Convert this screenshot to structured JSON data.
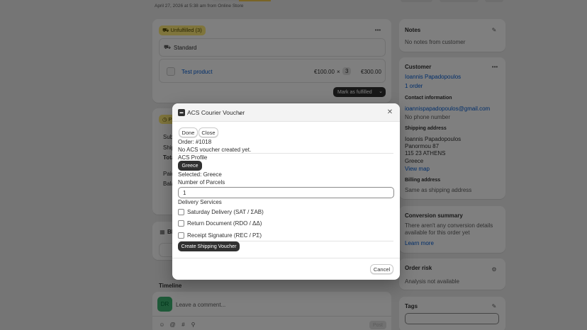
{
  "page": {
    "subtitle": "April 27, 2026 at 5:38 am from Online Store"
  },
  "fulfillment": {
    "badge": "Unfulfilled (3)",
    "delivery_method": "Standard",
    "product_name": "Test product",
    "unit_price": "€100.00",
    "times": "×",
    "quantity": "3",
    "line_total": "€300.00",
    "mark_fulfilled_label": "Mark as fulfilled"
  },
  "payment": {
    "badge_initial": "P",
    "rows": [
      "Sub",
      "Ship",
      "Tota",
      "Paid",
      "Bala"
    ]
  },
  "bl_section": {
    "label": "Bl"
  },
  "timeline": {
    "title": "Timeline",
    "avatar_initials": "DR",
    "comment_placeholder": "Leave a comment...",
    "post_label": "Post"
  },
  "sidebar": {
    "notes": {
      "title": "Notes",
      "text": "No notes from customer"
    },
    "customer": {
      "title": "Customer",
      "name": "Ioannis Papadopoulos",
      "orders": "1 order",
      "contact_title": "Contact information",
      "email": "ioannispapadopoulos@gmail.com",
      "phone": "No phone number",
      "shipping_title": "Shipping address",
      "shipping_lines": [
        "Ioannis Papadopoulos",
        "Panormou 87",
        "115 23 ATHENS",
        "Greece"
      ],
      "view_map": "View map",
      "billing_title": "Billing address",
      "billing_text": "Same as shipping address"
    },
    "conversion": {
      "title": "Conversion summary",
      "text_line1": "There aren't any conversion details",
      "text_line2": "available for this order yet",
      "learn_more": "Learn more"
    },
    "risk": {
      "title": "Order risk",
      "text": "Analysis not available"
    },
    "tags": {
      "title": "Tags"
    }
  },
  "modal": {
    "title": "ACS Courier Voucher",
    "done_label": "Done",
    "close_label": "Close",
    "order_line": "Order: #1018",
    "no_voucher": "No ACS voucher created yet.",
    "profile_label": "ACS Profile",
    "profile_button": "Greece",
    "selected_line": "Selected: Greece",
    "parcels_label": "Number of Parcels",
    "parcels_value": "1",
    "services_label": "Delivery Services",
    "services": [
      "Saturday Delivery (SAT / ΣΑΒ)",
      "Return Document (RDO / ΔΔ)",
      "Receipt Signature (REC / ΡΣ)"
    ],
    "create_button": "Create Shipping Voucher",
    "cancel_label": "Cancel"
  }
}
